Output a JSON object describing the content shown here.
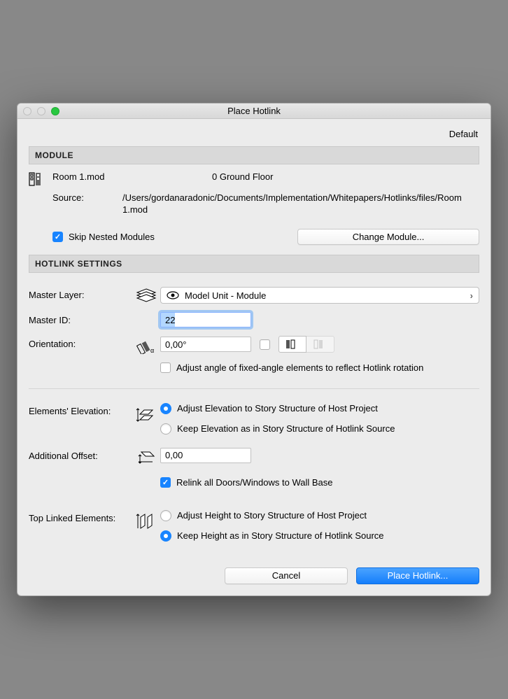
{
  "window": {
    "title": "Place Hotlink"
  },
  "top_link": "Default",
  "sections": {
    "module": "MODULE",
    "settings": "HOTLINK SETTINGS"
  },
  "module": {
    "file_name": "Room 1.mod",
    "floor": "0 Ground Floor",
    "source_label": "Source:",
    "source_path": "/Users/gordanaradonic/Documents/Implementation/Whitepapers/Hotlinks/files/Room 1.mod",
    "skip_label": "Skip Nested Modules",
    "change_btn": "Change Module..."
  },
  "settings": {
    "master_layer_label": "Master Layer:",
    "master_layer_value": "Model Unit - Module",
    "master_id_label": "Master ID:",
    "master_id_value": "22",
    "orientation_label": "Orientation:",
    "orientation_value": "0,00°",
    "adjust_angle_label": "Adjust angle of fixed-angle elements to reflect Hotlink rotation",
    "elevation_label": "Elements' Elevation:",
    "elevation_opt1": "Adjust Elevation to Story Structure of Host Project",
    "elevation_opt2": "Keep Elevation as in Story Structure of Hotlink Source",
    "offset_label": "Additional Offset:",
    "offset_value": "0,00",
    "relink_label": "Relink all Doors/Windows to Wall Base",
    "toplinked_label": "Top Linked Elements:",
    "toplinked_opt1": "Adjust Height to Story Structure of Host Project",
    "toplinked_opt2": "Keep Height as in Story Structure of Hotlink Source"
  },
  "footer": {
    "cancel": "Cancel",
    "ok": "Place Hotlink..."
  }
}
